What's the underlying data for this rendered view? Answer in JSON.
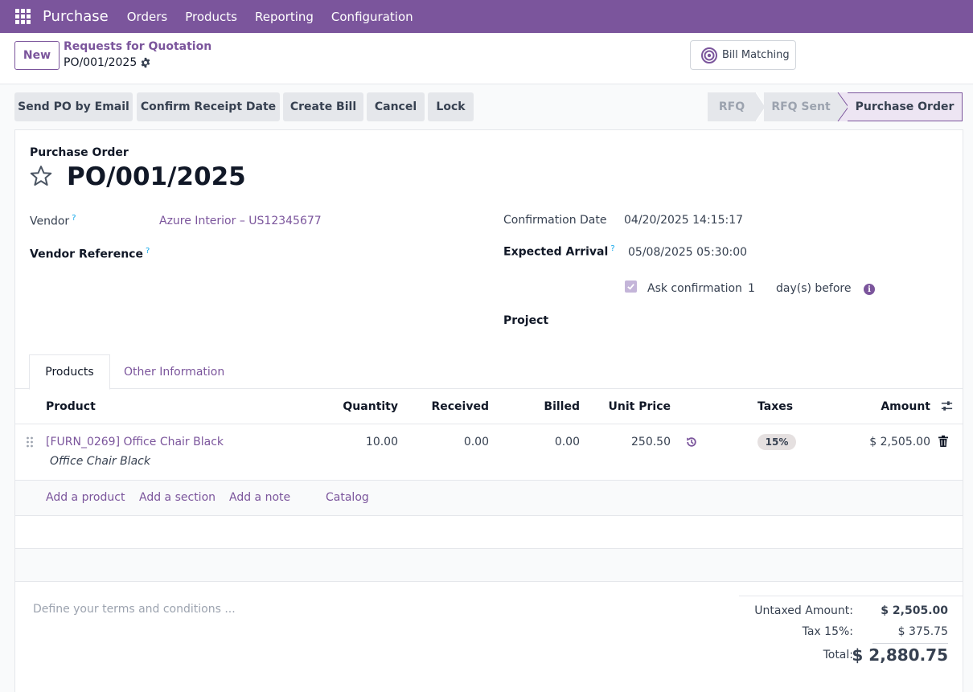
{
  "topbar": {
    "app_name": "Purchase",
    "menu": [
      "Orders",
      "Products",
      "Reporting",
      "Configuration"
    ]
  },
  "control_panel": {
    "new_label": "New",
    "breadcrumb_parent": "Requests for Quotation",
    "breadcrumb_current": "PO/001/2025",
    "bill_matching_label": "Bill Matching"
  },
  "actions": {
    "send_po": "Send PO by Email",
    "confirm_receipt": "Confirm Receipt Date",
    "create_bill": "Create Bill",
    "cancel": "Cancel",
    "lock": "Lock"
  },
  "statusbar": {
    "rfq": "RFQ",
    "rfq_sent": "RFQ Sent",
    "purchase_order": "Purchase Order",
    "active": "Purchase Order"
  },
  "form": {
    "type_label": "Purchase Order",
    "name": "PO/001/2025",
    "vendor_label": "Vendor",
    "vendor_value": "Azure Interior – US12345677",
    "vendor_ref_label": "Vendor Reference",
    "confirmation_date_label": "Confirmation Date",
    "confirmation_date_value": "04/20/2025 14:15:17",
    "expected_arrival_label": "Expected Arrival",
    "expected_arrival_value": "05/08/2025 05:30:00",
    "ask_confirmation_label": "Ask confirmation",
    "ask_confirmation_days": "1",
    "ask_confirmation_suffix": "day(s) before",
    "ask_confirmation_checked": true,
    "project_label": "Project",
    "help_mark": "?"
  },
  "tabs": {
    "products": "Products",
    "other_info": "Other Information",
    "active": "Products"
  },
  "lines": {
    "headers": {
      "product": "Product",
      "quantity": "Quantity",
      "received": "Received",
      "billed": "Billed",
      "unit_price": "Unit Price",
      "taxes": "Taxes",
      "amount": "Amount"
    },
    "rows": [
      {
        "product": "[FURN_0269] Office Chair Black",
        "description": "Office Chair Black",
        "quantity": "10.00",
        "received": "0.00",
        "billed": "0.00",
        "unit_price": "250.50",
        "taxes": "15%",
        "amount": "$ 2,505.00"
      }
    ],
    "add_product": "Add a product",
    "add_section": "Add a section",
    "add_note": "Add a note",
    "catalog": "Catalog"
  },
  "terms_placeholder": "Define your terms and conditions ...",
  "totals": {
    "untaxed_label": "Untaxed Amount:",
    "untaxed_value": "$ 2,505.00",
    "tax_label": "Tax 15%:",
    "tax_value": "$ 375.75",
    "total_label": "Total:",
    "total_value": "$ 2,880.75"
  },
  "colors": {
    "brand": "#7b559c",
    "status_active_bg": "#ede5f3"
  }
}
